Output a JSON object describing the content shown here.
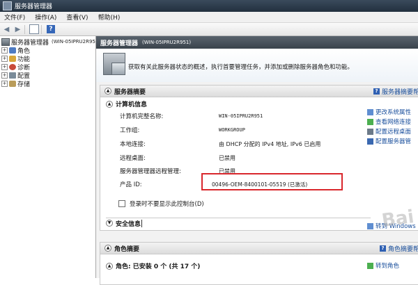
{
  "window": {
    "title": "服务器管理器"
  },
  "menu": [
    "文件(F)",
    "操作(A)",
    "查看(V)",
    "帮助(H)"
  ],
  "tree": {
    "root": {
      "label": "服务器管理器",
      "suffix": "(WIN-05IPRU2R95"
    },
    "items": [
      "角色",
      "功能",
      "诊断",
      "配置",
      "存储"
    ]
  },
  "main": {
    "header": {
      "title": "服务器管理器",
      "suffix": "(WIN-05IPRU2R951)"
    },
    "intro": "获取有关此服务器状态的概述，执行首要管理任务，并添加或删除服务器角色和功能。",
    "summary": {
      "title": "服务器摘要",
      "help_link": "服务器摘要帮",
      "computer_info": {
        "title": "计算机信息",
        "rows": [
          {
            "label": "计算机完整名称:",
            "value": "WIN-05IPRU2R951"
          },
          {
            "label": "工作组:",
            "value": "WORKGROUP"
          },
          {
            "label": "本地连接:",
            "value": "由 DHCP 分配的 IPv4 地址, IPv6 已启用"
          },
          {
            "label": "远程桌面:",
            "value": "已禁用"
          },
          {
            "label": "服务器管理器远程管理:",
            "value": "已禁用"
          },
          {
            "label": "产品 ID:",
            "value": "00496-OEM-8400101-05519 (已激活)"
          }
        ],
        "checkbox_label": "登录时不要显示此控制台(D)"
      },
      "tasks": [
        "更改系统属性",
        "查看网络连接",
        "配置远程桌面",
        "配置服务器管"
      ],
      "security": {
        "title": "安全信息",
        "link": "转到 Windows"
      }
    },
    "roles": {
      "title": "角色摘要",
      "help_link": "角色摘要帮",
      "subtitle": "角色: 已安装 0 个 (共 17 个)",
      "task": "转到角色"
    }
  },
  "watermark": "Bai"
}
